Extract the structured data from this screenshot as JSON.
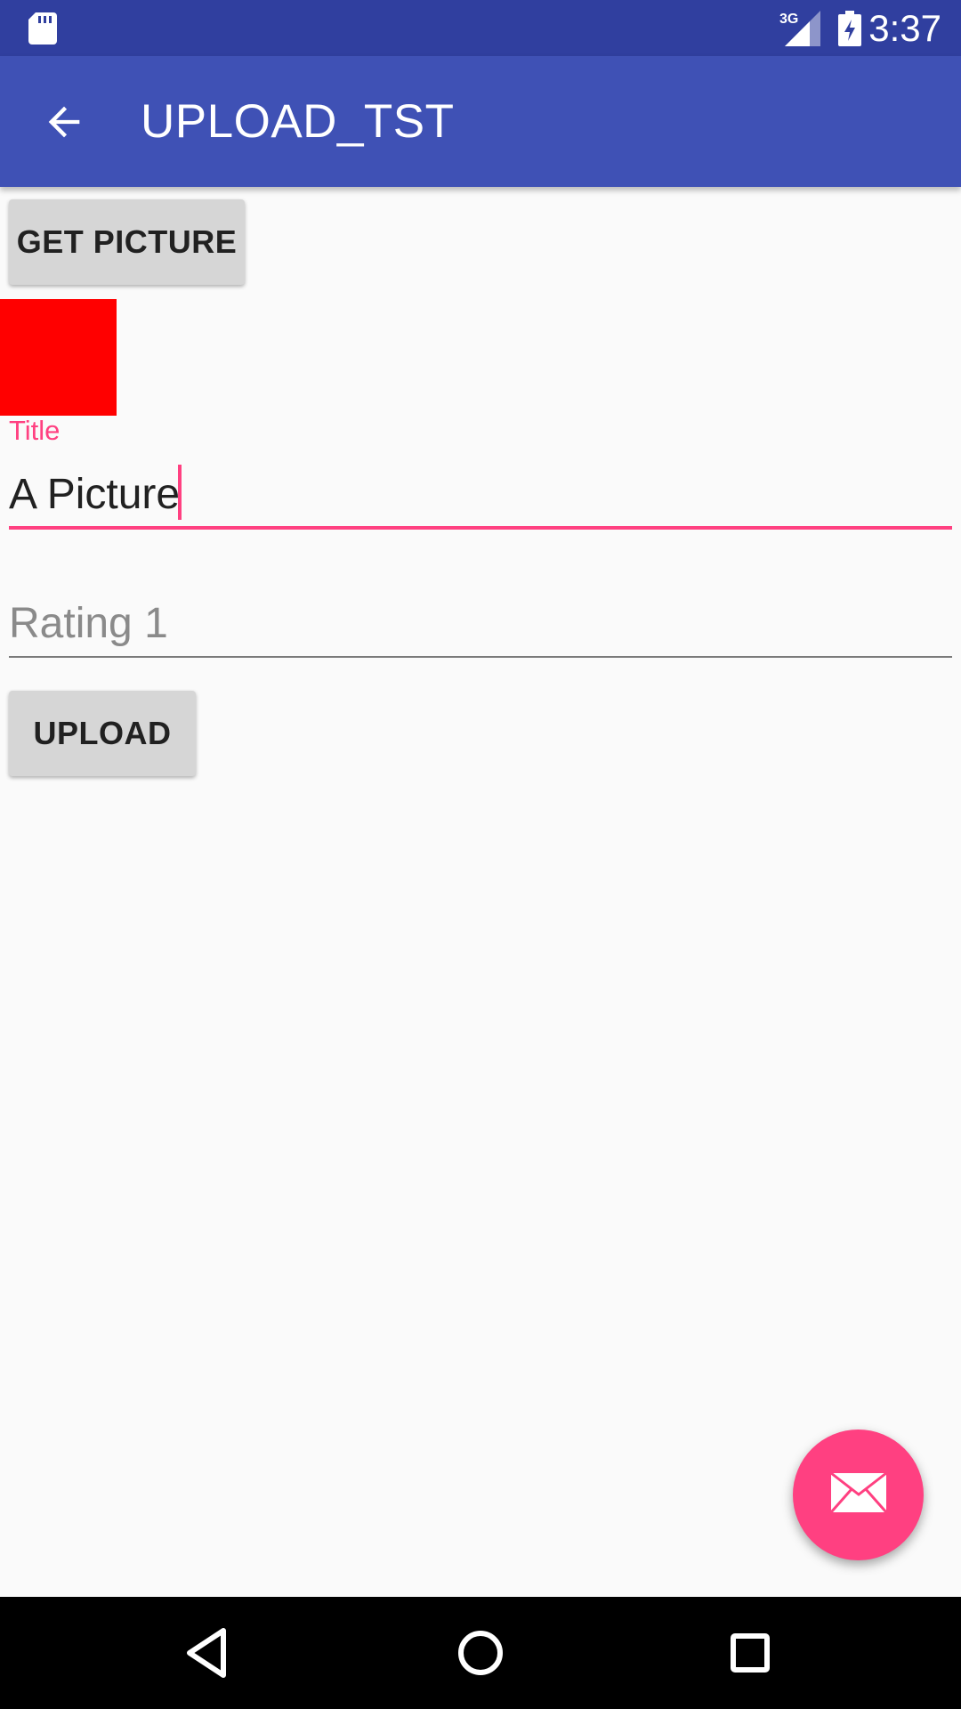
{
  "status_bar": {
    "time": "3:37",
    "network_label": "3G",
    "icons": [
      "sd-card-icon",
      "signal-3g-icon",
      "battery-charging-icon"
    ]
  },
  "app_bar": {
    "title": "UPLOAD_TST",
    "back_icon": "arrow-back-icon"
  },
  "form": {
    "get_picture_label": "GET PICTURE",
    "title_label": "Title",
    "title_value": "A Picture",
    "rating_placeholder": "Rating 1",
    "upload_label": "UPLOAD"
  },
  "fab": {
    "icon": "email-icon"
  },
  "nav_bar": {
    "icons": [
      "nav-back-icon",
      "nav-home-icon",
      "nav-recents-icon"
    ]
  },
  "colors": {
    "status_bar": "#303f9f",
    "app_bar": "#3f51b5",
    "accent": "#ff4081",
    "preview": "#ff0000",
    "background": "#fafafa"
  }
}
